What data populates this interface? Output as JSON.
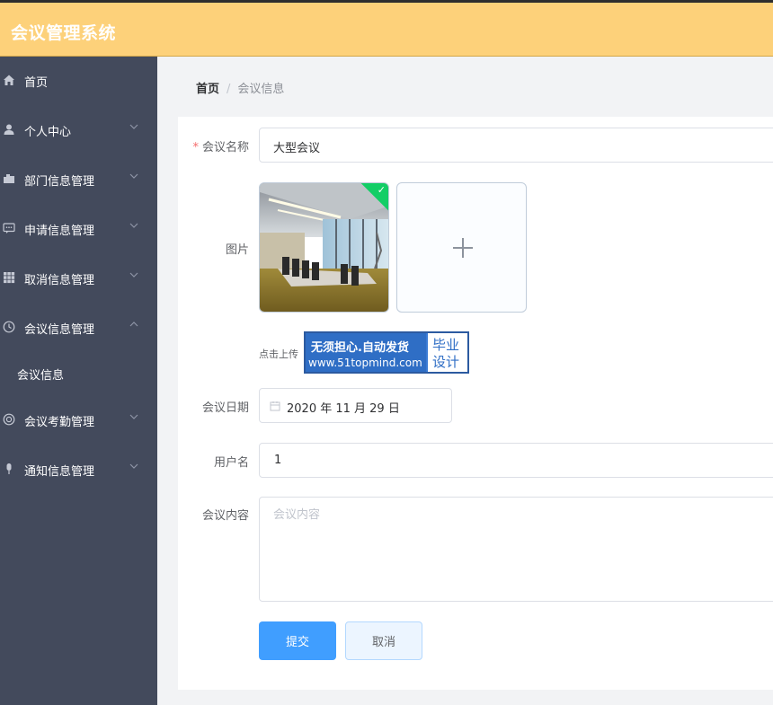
{
  "app": {
    "title": "会议管理系统"
  },
  "sidebar": {
    "items": [
      {
        "label": "首页",
        "icon": "home-icon",
        "expandable": false
      },
      {
        "label": "个人中心",
        "icon": "user-icon",
        "expandable": true
      },
      {
        "label": "部门信息管理",
        "icon": "folder-icon",
        "expandable": true
      },
      {
        "label": "申请信息管理",
        "icon": "chat-icon",
        "expandable": true
      },
      {
        "label": "取消信息管理",
        "icon": "grid-icon",
        "expandable": true
      },
      {
        "label": "会议信息管理",
        "icon": "clock-icon",
        "expandable": true,
        "expanded": true
      },
      {
        "label": "会议考勤管理",
        "icon": "lifebuoy-icon",
        "expandable": true
      },
      {
        "label": "通知信息管理",
        "icon": "mic-icon",
        "expandable": true
      }
    ],
    "subitems": [
      {
        "label": "会议信息"
      }
    ]
  },
  "breadcrumb": {
    "home": "首页",
    "separator": "/",
    "current": "会议信息"
  },
  "form": {
    "name": {
      "label": "会议名称",
      "value": "大型会议",
      "required": "*"
    },
    "image": {
      "label": "图片",
      "tip": "点击上传"
    },
    "date": {
      "label": "会议日期",
      "value": "2020 年 11 月 29 日"
    },
    "username": {
      "label": "用户名",
      "value": "1"
    },
    "content": {
      "label": "会议内容",
      "placeholder": "会议内容"
    }
  },
  "watermark": {
    "line1": "无须担心.自动发货",
    "line2": "www.51topmind.com",
    "right1": "毕业",
    "right2": "设计"
  },
  "buttons": {
    "submit": "提交",
    "cancel": "取消"
  },
  "colors": {
    "topbar": "#fdd17a",
    "sidebar": "#434a5c",
    "primary": "#409eff",
    "success": "#13ce66"
  }
}
